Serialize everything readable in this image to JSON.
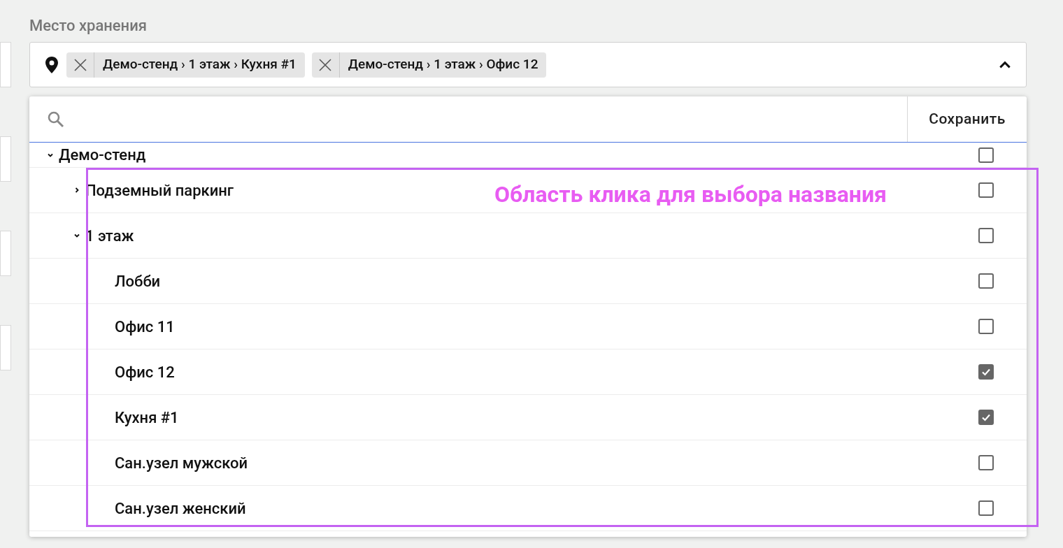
{
  "field": {
    "label": "Место хранения",
    "chips": [
      {
        "text": "Демо-стенд › 1 этаж › Кухня #1"
      },
      {
        "text": "Демо-стенд › 1 этаж › Офис 12"
      }
    ],
    "expanded": true
  },
  "dropdown": {
    "save_button": "Сохранить",
    "tree": [
      {
        "label": "Демо-стенд",
        "expanded": true,
        "checked": false,
        "children": [
          {
            "label": "Подземный паркинг",
            "expanded": false,
            "checked": false
          },
          {
            "label": "1 этаж",
            "expanded": true,
            "checked": false,
            "children": [
              {
                "label": "Лобби",
                "checked": false
              },
              {
                "label": "Офис 11",
                "checked": false
              },
              {
                "label": "Офис 12",
                "checked": true
              },
              {
                "label": "Кухня #1",
                "checked": true
              },
              {
                "label": "Сан.узел мужской",
                "checked": false
              },
              {
                "label": "Сан.узел женский",
                "checked": false
              }
            ]
          }
        ]
      }
    ]
  },
  "annotation": {
    "text": "Область клика для выбора названия"
  }
}
